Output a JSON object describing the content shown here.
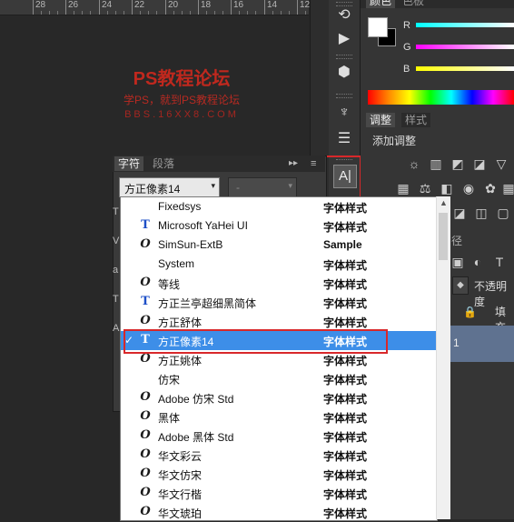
{
  "ruler": {
    "labels": [
      "28",
      "26",
      "24",
      "22",
      "20",
      "18",
      "16",
      "14",
      "12"
    ]
  },
  "watermark": {
    "line1": "PS教程论坛",
    "line2": "学PS，就到PS教程论坛",
    "line3": "BBS.16XX8.COM"
  },
  "color_panel": {
    "tabs": [
      "颜色",
      "色板"
    ],
    "channels": [
      "R",
      "G",
      "B"
    ],
    "foreground": "#ffffff",
    "background": "#000000"
  },
  "adjust_panel": {
    "tabs": [
      "调整",
      "样式"
    ],
    "title": "添加调整"
  },
  "layers_panel": {
    "tab_fragment": "径",
    "opacity_label": "不透明度",
    "fill_label": "填充",
    "layer_fragment": "1"
  },
  "char_panel": {
    "tabs": [
      "字符",
      "段落"
    ],
    "font_value": "方正像素14",
    "style_value": "-",
    "arrow": "▾",
    "menu_arrows": "▸▸",
    "left_letters": [
      "T",
      "V",
      "a",
      "T",
      "A"
    ]
  },
  "font_list": [
    {
      "icon": "none",
      "name": "Fixedsys",
      "sample": "字体样式"
    },
    {
      "icon": "tt",
      "name": "Microsoft YaHei UI",
      "sample": "字体样式"
    },
    {
      "icon": "ot",
      "name": "SimSun-ExtB",
      "sample": "Sample"
    },
    {
      "icon": "none",
      "name": "System",
      "sample": "字体样式"
    },
    {
      "icon": "ot",
      "name": "等线",
      "sample": "字体样式"
    },
    {
      "icon": "tt",
      "name": "方正兰亭超细黑简体",
      "sample": "字体样式"
    },
    {
      "icon": "ot",
      "name": "方正舒体",
      "sample": "字体样式"
    },
    {
      "icon": "tt",
      "name": "方正像素14",
      "sample": "字体样式",
      "selected": true
    },
    {
      "icon": "ot",
      "name": "方正姚体",
      "sample": "字体样式"
    },
    {
      "icon": "none",
      "name": "仿宋",
      "sample": "字体样式"
    },
    {
      "icon": "ot",
      "name": "Adobe 仿宋 Std",
      "sample": "字体样式"
    },
    {
      "icon": "ot",
      "name": "黑体",
      "sample": "字体样式"
    },
    {
      "icon": "ot",
      "name": "Adobe 黑体 Std",
      "sample": "字体样式"
    },
    {
      "icon": "ot",
      "name": "华文彩云",
      "sample": "字体样式"
    },
    {
      "icon": "ot",
      "name": "华文仿宋",
      "sample": "字体样式"
    },
    {
      "icon": "ot",
      "name": "华文行楷",
      "sample": "字体样式"
    },
    {
      "icon": "ot",
      "name": "华文琥珀",
      "sample": "字体样式"
    }
  ],
  "icons": {
    "ot": "O",
    "tt": "T",
    "checkmark": "✓",
    "type_tool": "A|"
  },
  "accent": {
    "highlight_red": "#d8282a",
    "selection_blue": "#3d8ee8",
    "layer_blue": "#5f7290"
  }
}
